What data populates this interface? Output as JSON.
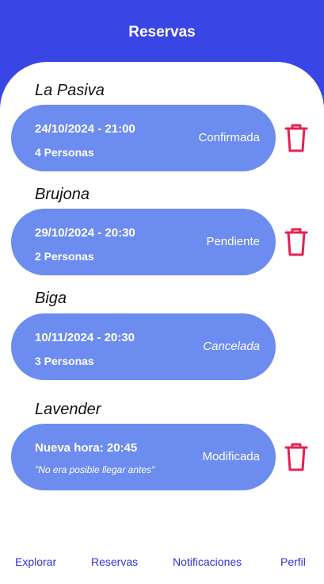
{
  "header": {
    "title": "Reservas"
  },
  "reservations": [
    {
      "restaurant": "La Pasiva",
      "line1": "24/10/2024 - 21:00",
      "line2": "4 Personas",
      "status": "Confirmada"
    },
    {
      "restaurant": "Brujona",
      "line1": "29/10/2024 - 20:30",
      "line2": "2 Personas",
      "status": "Pendiente"
    },
    {
      "restaurant": "Biga",
      "line1": "10/11/2024 - 20:30",
      "line2": "3 Personas",
      "status": "Cancelada"
    },
    {
      "restaurant": "Lavender",
      "line1": "Nueva hora: 20:45",
      "note": "\"No era posible llegar antes\"",
      "status": "Modificada"
    }
  ],
  "nav": {
    "explore": "Explorar",
    "reservations": "Reservas",
    "notifications": "Notificaciones",
    "profile": "Perfil"
  },
  "colors": {
    "header": "#3a45e6",
    "card": "#6d8cf0",
    "trash": "#e8204f",
    "nav_text": "#2d35d8"
  },
  "icons": {
    "delete": "trash-icon"
  }
}
